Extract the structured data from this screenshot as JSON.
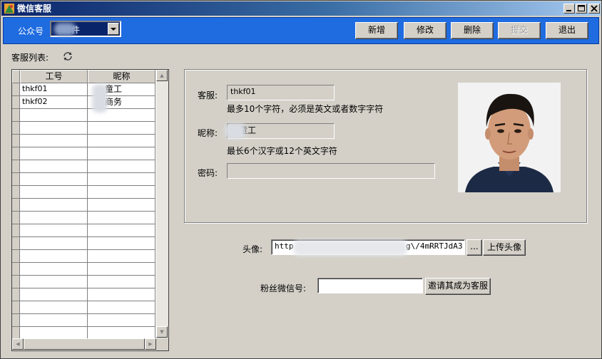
{
  "window": {
    "title": "微信客服"
  },
  "toolbar": {
    "account_label": "公众号",
    "account_value": "件",
    "buttons": {
      "add": "新增",
      "edit": "修改",
      "delete": "删除",
      "submit": "提交",
      "exit": "退出"
    }
  },
  "list": {
    "label": "客服列表:",
    "columns": [
      "工号",
      "昵称"
    ],
    "rows": [
      {
        "id": "thkf01",
        "nick": "童工"
      },
      {
        "id": "thkf02",
        "nick": "商务"
      }
    ]
  },
  "detail": {
    "account_label": "客服:",
    "account_value": "thkf01",
    "account_hint": "最多10个字符，必须是英文或者数字字符",
    "nick_label": "昵称:",
    "nick_value": "童工",
    "nick_hint": "最长6个汉字或12个英文字符",
    "password_label": "密码:",
    "password_value": ""
  },
  "avatar": {
    "label": "头像:",
    "url_value": "http",
    "url_value_tail": "g\\/4mRRTJdA3",
    "browse_label": "...",
    "upload_label": "上传头像"
  },
  "invite": {
    "label": "粉丝微信号:",
    "value": "",
    "button_label": "邀请其成为客服"
  },
  "colors": {
    "toolbar": "#1f6be0",
    "title_start": "#0a246a",
    "title_end": "#a6caf0",
    "face": "#d4d0c8"
  }
}
